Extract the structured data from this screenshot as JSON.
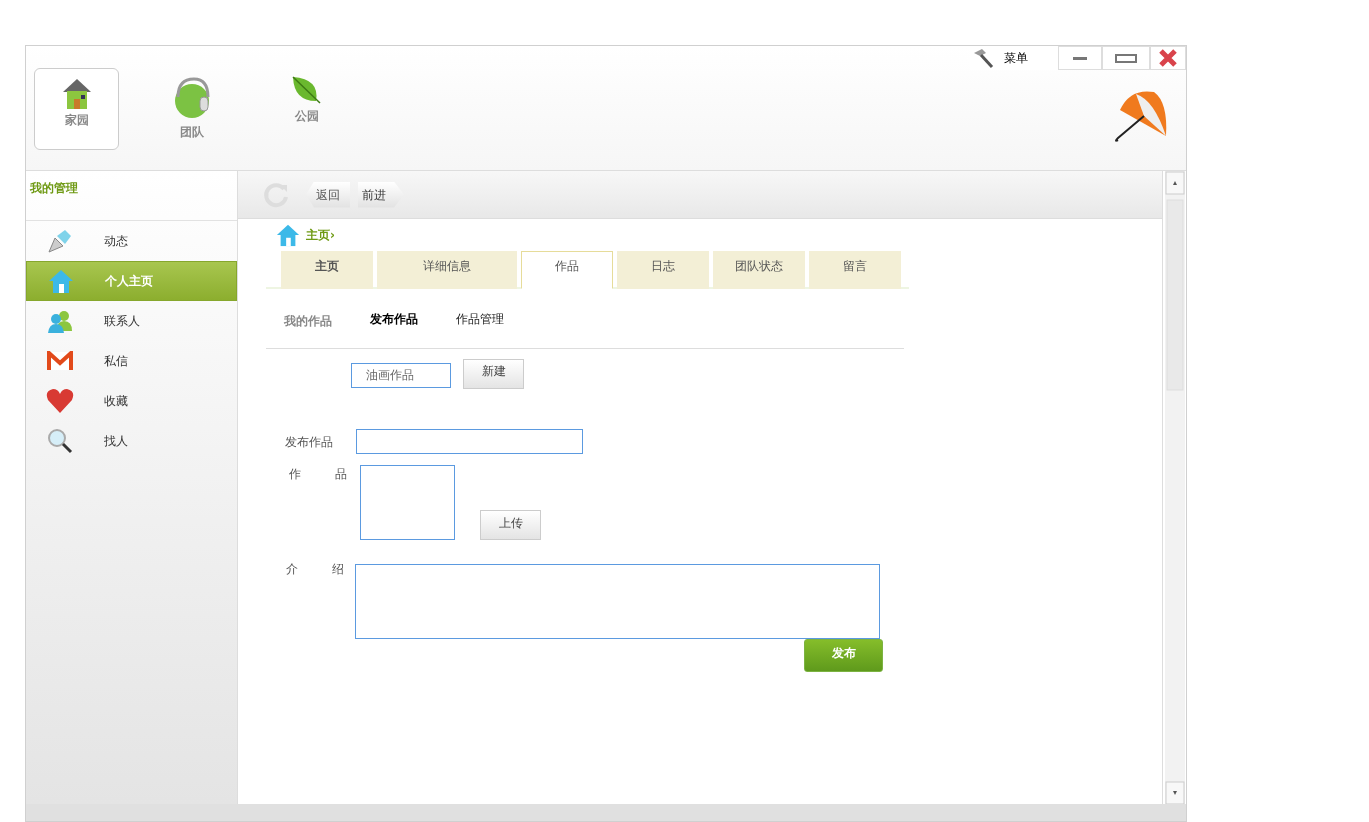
{
  "top_bar": {
    "menu": "菜单"
  },
  "nav": [
    {
      "label": "家园",
      "selected": true
    },
    {
      "label": "团队",
      "selected": false
    },
    {
      "label": "公园",
      "selected": false
    }
  ],
  "sidebar": {
    "title": "我的管理",
    "items": [
      {
        "label": "动态",
        "selected": false
      },
      {
        "label": "个人主页",
        "selected": true
      },
      {
        "label": "联系人",
        "selected": false
      },
      {
        "label": "私信",
        "selected": false
      },
      {
        "label": "收藏",
        "selected": false
      },
      {
        "label": "找人",
        "selected": false
      }
    ]
  },
  "toolbar": {
    "back": "返回",
    "forward": "前进"
  },
  "breadcrumb": "主页›",
  "tabs": [
    {
      "label": "主页",
      "selected": false
    },
    {
      "label": "详细信息",
      "selected": false
    },
    {
      "label": "作品",
      "selected": true
    },
    {
      "label": "日志",
      "selected": false
    },
    {
      "label": "团队状态",
      "selected": false
    },
    {
      "label": "留言",
      "selected": false
    }
  ],
  "subnav": {
    "label": "我的作品",
    "items": [
      {
        "label": "发布作品",
        "selected": true
      },
      {
        "label": "作品管理",
        "selected": false
      }
    ]
  },
  "category": {
    "value": "油画作品",
    "button": "新建"
  },
  "form": {
    "title_label": "发布作品",
    "work_label": "作 品",
    "upload": "上传",
    "intro_label": "介 绍",
    "submit": "发布"
  }
}
